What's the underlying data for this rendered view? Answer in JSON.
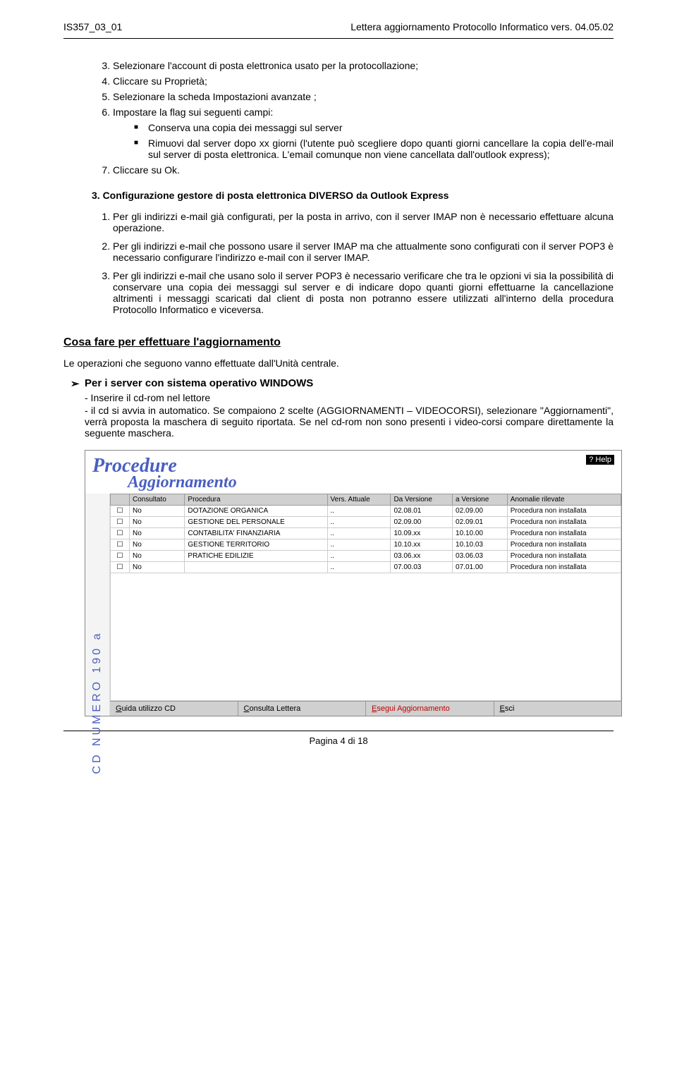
{
  "header": {
    "doc_id": "IS357_03_01",
    "doc_title": "Lettera aggiornamento Protocollo Informatico vers. 04.05.02"
  },
  "steps_main": {
    "s3": "Selezionare l'account di posta elettronica usato per la protocollazione;",
    "s4": "Cliccare su Proprietà;",
    "s5": "Selezionare la scheda Impostazioni avanzate ;",
    "s6": "Impostare la flag sui seguenti campi:",
    "s6_b1": "Conserva una copia dei messaggi sul server",
    "s6_b2": "Rimuovi dal server dopo xx giorni (l'utente può scegliere dopo quanti giorni cancellare la copia dell'e-mail sul server di posta elettronica. L'email comunque non viene cancellata dall'outlook express);",
    "s7": "Cliccare su Ok."
  },
  "section3_heading": "3.   Configurazione gestore di posta elettronica DIVERSO da Outlook Express",
  "section3": {
    "i1": "Per gli indirizzi e-mail già configurati, per la posta in arrivo, con il server IMAP non è necessario effettuare alcuna operazione.",
    "i2": "Per gli indirizzi e-mail che possono usare il server IMAP ma che attualmente sono configurati con il server POP3 è necessario configurare l'indirizzo e-mail con il server IMAP.",
    "i3": "Per gli indirizzi e-mail che usano solo il server POP3 è necessario verificare che tra le opzioni vi sia la possibilità di conservare una copia dei messaggi sul server e di indicare dopo quanti giorni effettuarne la cancellazione altrimenti i messaggi scaricati dal client di posta non potranno essere utilizzati all'interno della procedura Protocollo Informatico e viceversa."
  },
  "update_heading": "Cosa fare per effettuare l'aggiornamento",
  "update_intro": "Le operazioni che seguono vanno effettuate dall'Unità centrale.",
  "windows_heading": "Per i server con sistema operativo WINDOWS",
  "dash1": "- Inserire il cd-rom nel lettore",
  "dash2": "- il cd si avvia in automatico. Se compaiono 2 scelte (AGGIORNAMENTI – VIDEOCORSI), selezionare \"Aggiornamenti\", verrà proposta la maschera di seguito riportata. Se nel cd-rom non sono presenti i video-corsi compare direttamente la seguente maschera.",
  "app": {
    "title1": "Procedure",
    "title2": "Aggiornamento",
    "help": "? Help",
    "side": "CD NUMERO 190 a",
    "cols": {
      "c0": "",
      "c1": "Consultato",
      "c2": "Procedura",
      "c3": "Vers. Attuale",
      "c4": "Da Versione",
      "c5": "a Versione",
      "c6": "Anomalie rilevate"
    },
    "rows": [
      {
        "cons": "No",
        "proc": "DOTAZIONE ORGANICA",
        "va": "..",
        "dv": "02.08.01",
        "av": "02.09.00",
        "an": "Procedura non installata"
      },
      {
        "cons": "No",
        "proc": "GESTIONE DEL PERSONALE",
        "va": "..",
        "dv": "02.09.00",
        "av": "02.09.01",
        "an": "Procedura non installata"
      },
      {
        "cons": "No",
        "proc": "CONTABILITA' FINANZIARIA",
        "va": "..",
        "dv": "10.09.xx",
        "av": "10.10.00",
        "an": "Procedura non installata"
      },
      {
        "cons": "No",
        "proc": "GESTIONE TERRITORIO",
        "va": "..",
        "dv": "10.10.xx",
        "av": "10.10.03",
        "an": "Procedura non installata"
      },
      {
        "cons": "No",
        "proc": "PRATICHE EDILIZIE",
        "va": "..",
        "dv": "03.06.xx",
        "av": "03.06.03",
        "an": "Procedura non installata"
      },
      {
        "cons": "No",
        "proc": "",
        "va": "..",
        "dv": "07.00.03",
        "av": "07.01.00",
        "an": "Procedura non installata"
      }
    ],
    "footer": {
      "f1": "Guida utilizzo CD",
      "f2": "Consulta Lettera",
      "f3": "Esegui Aggiornamento",
      "f4": "Esci"
    }
  },
  "page_footer": "Pagina 4 di 18"
}
